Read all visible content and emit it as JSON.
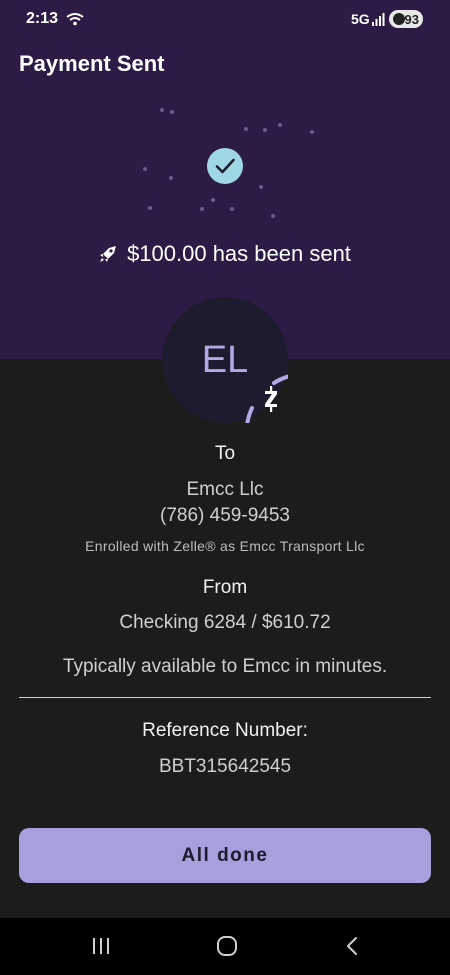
{
  "status_bar": {
    "time": "2:13",
    "network": "5G",
    "battery": "93"
  },
  "header": {
    "title": "Payment Sent"
  },
  "confirmation": {
    "sent_message": "$100.00 has been sent"
  },
  "recipient": {
    "initials": "EL",
    "to_label": "To",
    "name": "Emcc Llc",
    "phone": "(786) 459-9453",
    "enrolled": "Enrolled with Zelle® as Emcc Transport Llc"
  },
  "sender": {
    "from_label": "From",
    "account": "Checking 6284 / $610.72"
  },
  "availability": "Typically available to Emcc in minutes.",
  "reference": {
    "label": "Reference Number:",
    "value": "BBT315642545"
  },
  "actions": {
    "done_label": "All done"
  },
  "colors": {
    "header_bg": "#2c1c45",
    "body_bg": "#1c1c1c",
    "accent": "#a6a0dd",
    "check_bg": "#9fd8e4"
  },
  "icons": {
    "status": [
      "wifi-icon",
      "signal-icon",
      "battery-icon"
    ],
    "hero": [
      "checkmark-icon",
      "rocket-icon",
      "zelle-icon"
    ],
    "nav": [
      "recents-icon",
      "home-icon",
      "back-icon"
    ]
  }
}
